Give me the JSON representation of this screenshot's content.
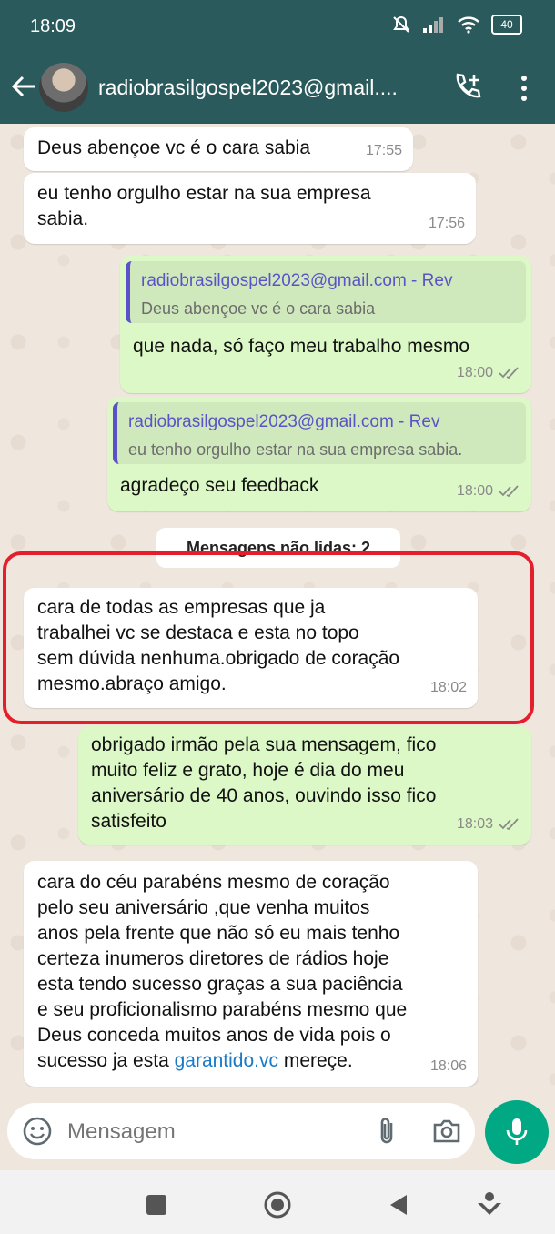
{
  "status": {
    "time": "18:09",
    "battery": "40"
  },
  "header": {
    "contact_name": "radiobrasilgospel2023@gmail...."
  },
  "messages": [
    {
      "dir": "in",
      "text": "Deus abençoe vc é o cara sabia",
      "time": "17:55"
    },
    {
      "dir": "in",
      "text": "eu tenho orgulho estar na sua empresa\nsabia.",
      "time": "17:56"
    },
    {
      "dir": "out",
      "quote_title": "radiobrasilgospel2023@gmail.com - Rev",
      "quote_body": "Deus abençoe vc é o cara sabia",
      "text": "que nada, só faço meu trabalho mesmo",
      "time": "18:00"
    },
    {
      "dir": "out",
      "quote_title": "radiobrasilgospel2023@gmail.com - Rev",
      "quote_body": "eu tenho orgulho estar na sua empresa sabia.",
      "text": "agradeço seu feedback",
      "time": "18:00"
    },
    {
      "dir": "in",
      "text": "cara de todas as empresas que ja\ntrabalhei vc se destaca e esta no topo\nsem dúvida nenhuma.obrigado de coração\nmesmo.abraço amigo.",
      "time": "18:02"
    },
    {
      "dir": "out",
      "text": "obrigado irmão pela sua mensagem, fico\nmuito feliz e grato, hoje é dia do meu\naniversário de 40 anos, ouvindo isso fico\nsatisfeito",
      "time": "18:03"
    },
    {
      "dir": "in",
      "text_before_link": "cara do céu parabéns mesmo de coração\npelo seu aniversário ,que venha muitos\nanos pela frente que não só eu mais tenho\ncerteza inumeros diretores de rádios hoje\nesta tendo sucesso graças a sua paciência\ne seu proficionalismo parabéns mesmo que\nDeus conceda muitos anos de vida pois o\nsucesso ja esta ",
      "link_text": "garantido.vc",
      "text_after_link": " mereçe.",
      "time": "18:06"
    }
  ],
  "unread_banner": "Mensagens não lidas: 2",
  "input": {
    "placeholder": "Mensagem"
  },
  "colors": {
    "header": "#2b5a5c",
    "outgoing": "#dcf8c6",
    "incoming": "#ffffff",
    "accent": "#00a884",
    "highlight": "#e41e2b",
    "quote_bar": "#5b52c9"
  },
  "icons": [
    "back-arrow-icon",
    "add-call-icon",
    "more-vert-icon",
    "emoji-icon",
    "attach-icon",
    "camera-icon",
    "mic-icon",
    "read-ticks-icon",
    "nav-square-icon",
    "nav-home-icon",
    "nav-back-icon",
    "nav-assistant-icon"
  ]
}
